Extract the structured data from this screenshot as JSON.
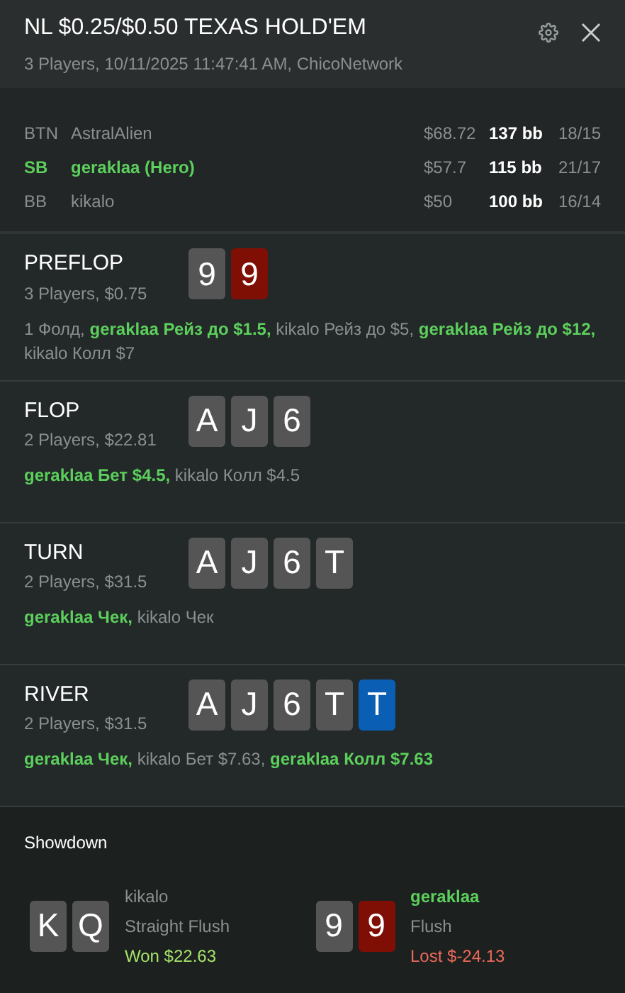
{
  "header": {
    "title": "NL $0.25/$0.50 TEXAS HOLD'EM",
    "subtitle": "3 Players, 10/11/2025 11:47:41 AM, ChicoNetwork"
  },
  "players": [
    {
      "position": "BTN",
      "name": "AstralAlien",
      "hero": false,
      "stack": "$68.72",
      "bb": "137 bb",
      "stats": "18/15"
    },
    {
      "position": "SB",
      "name": "geraklaa (Hero)",
      "hero": true,
      "stack": "$57.7",
      "bb": "115 bb",
      "stats": "21/17"
    },
    {
      "position": "BB",
      "name": "kikalo",
      "hero": false,
      "stack": "$50",
      "bb": "100 bb",
      "stats": "16/14"
    }
  ],
  "streets": [
    {
      "name": "PREFLOP",
      "info": "3 Players, $0.75",
      "cards": [
        {
          "rank": "9",
          "color": "#555555"
        },
        {
          "rank": "9",
          "color": "#7f0f05"
        }
      ],
      "actions": [
        {
          "text": "1 Фолд,",
          "hero": false
        },
        {
          "text": "geraklaa Рейз до $1.5,",
          "hero": true
        },
        {
          "text": "kikalo Рейз до $5,",
          "hero": false
        },
        {
          "text": "geraklaa Рейз до $12,",
          "hero": true
        },
        {
          "text": "kikalo Колл $7",
          "hero": false
        }
      ]
    },
    {
      "name": "FLOP",
      "info": "2 Players, $22.81",
      "cards": [
        {
          "rank": "A",
          "color": "#555555"
        },
        {
          "rank": "J",
          "color": "#555555"
        },
        {
          "rank": "6",
          "color": "#555555"
        }
      ],
      "actions": [
        {
          "text": "geraklaa Бет $4.5,",
          "hero": true
        },
        {
          "text": "kikalo Колл $4.5",
          "hero": false
        }
      ]
    },
    {
      "name": "TURN",
      "info": "2 Players, $31.5",
      "cards": [
        {
          "rank": "A",
          "color": "#555555"
        },
        {
          "rank": "J",
          "color": "#555555"
        },
        {
          "rank": "6",
          "color": "#555555"
        },
        {
          "rank": "T",
          "color": "#555555"
        }
      ],
      "actions": [
        {
          "text": "geraklaa Чек,",
          "hero": true
        },
        {
          "text": "kikalo Чек",
          "hero": false
        }
      ]
    },
    {
      "name": "RIVER",
      "info": "2 Players, $31.5",
      "cards": [
        {
          "rank": "A",
          "color": "#555555"
        },
        {
          "rank": "J",
          "color": "#555555"
        },
        {
          "rank": "6",
          "color": "#555555"
        },
        {
          "rank": "T",
          "color": "#555555"
        },
        {
          "rank": "T",
          "color": "#0a5fb4"
        }
      ],
      "actions": [
        {
          "text": "geraklaa Чек,",
          "hero": true
        },
        {
          "text": "kikalo Бет $7.63,",
          "hero": false
        },
        {
          "text": "geraklaa Колл $7.63",
          "hero": true
        }
      ]
    }
  ],
  "showdown": {
    "title": "Showdown",
    "hands": [
      {
        "name": "kikalo",
        "hero": false,
        "cards": [
          {
            "rank": "K",
            "color": "#555555"
          },
          {
            "rank": "Q",
            "color": "#555555"
          }
        ],
        "hand": "Straight Flush",
        "result": {
          "kind": "won",
          "text": "Won $22.63"
        }
      },
      {
        "name": "geraklaa",
        "hero": true,
        "cards": [
          {
            "rank": "9",
            "color": "#555555"
          },
          {
            "rank": "9",
            "color": "#7f0f05"
          }
        ],
        "hand": "Flush",
        "result": {
          "kind": "lost",
          "text": "Lost $-24.13"
        }
      }
    ]
  }
}
